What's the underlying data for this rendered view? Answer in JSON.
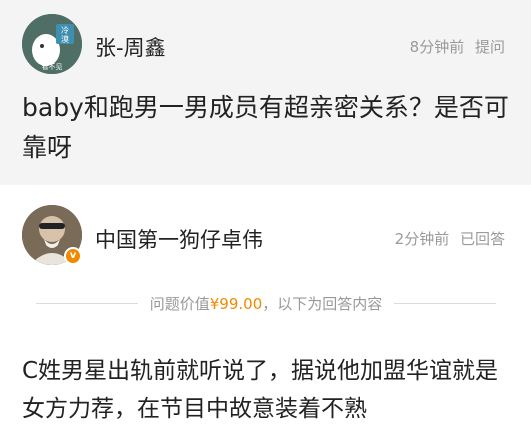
{
  "question": {
    "asker_name": "张-周鑫",
    "time": "8分钟前",
    "action": "提问",
    "avatar_caption": "看不见",
    "avatar_badge": "冷\n漠",
    "text": "baby和跑男一男成员有超亲密关系？是否可靠呀"
  },
  "answer": {
    "answerer_name": "中国第一狗仔卓伟",
    "time": "2分钟前",
    "status": "已回答",
    "verified_icon": "v",
    "price_label_prefix": "问题价值",
    "price": "¥99.00",
    "price_label_suffix": "，以下为回答内容",
    "text": "C姓男星出轨前就听说了，据说他加盟华谊就是女方力荐，在节目中故意装着不熟"
  },
  "colors": {
    "accent": "#f08a00",
    "question_bg": "#f4f4f4",
    "meta_text": "#9a9a9a"
  }
}
